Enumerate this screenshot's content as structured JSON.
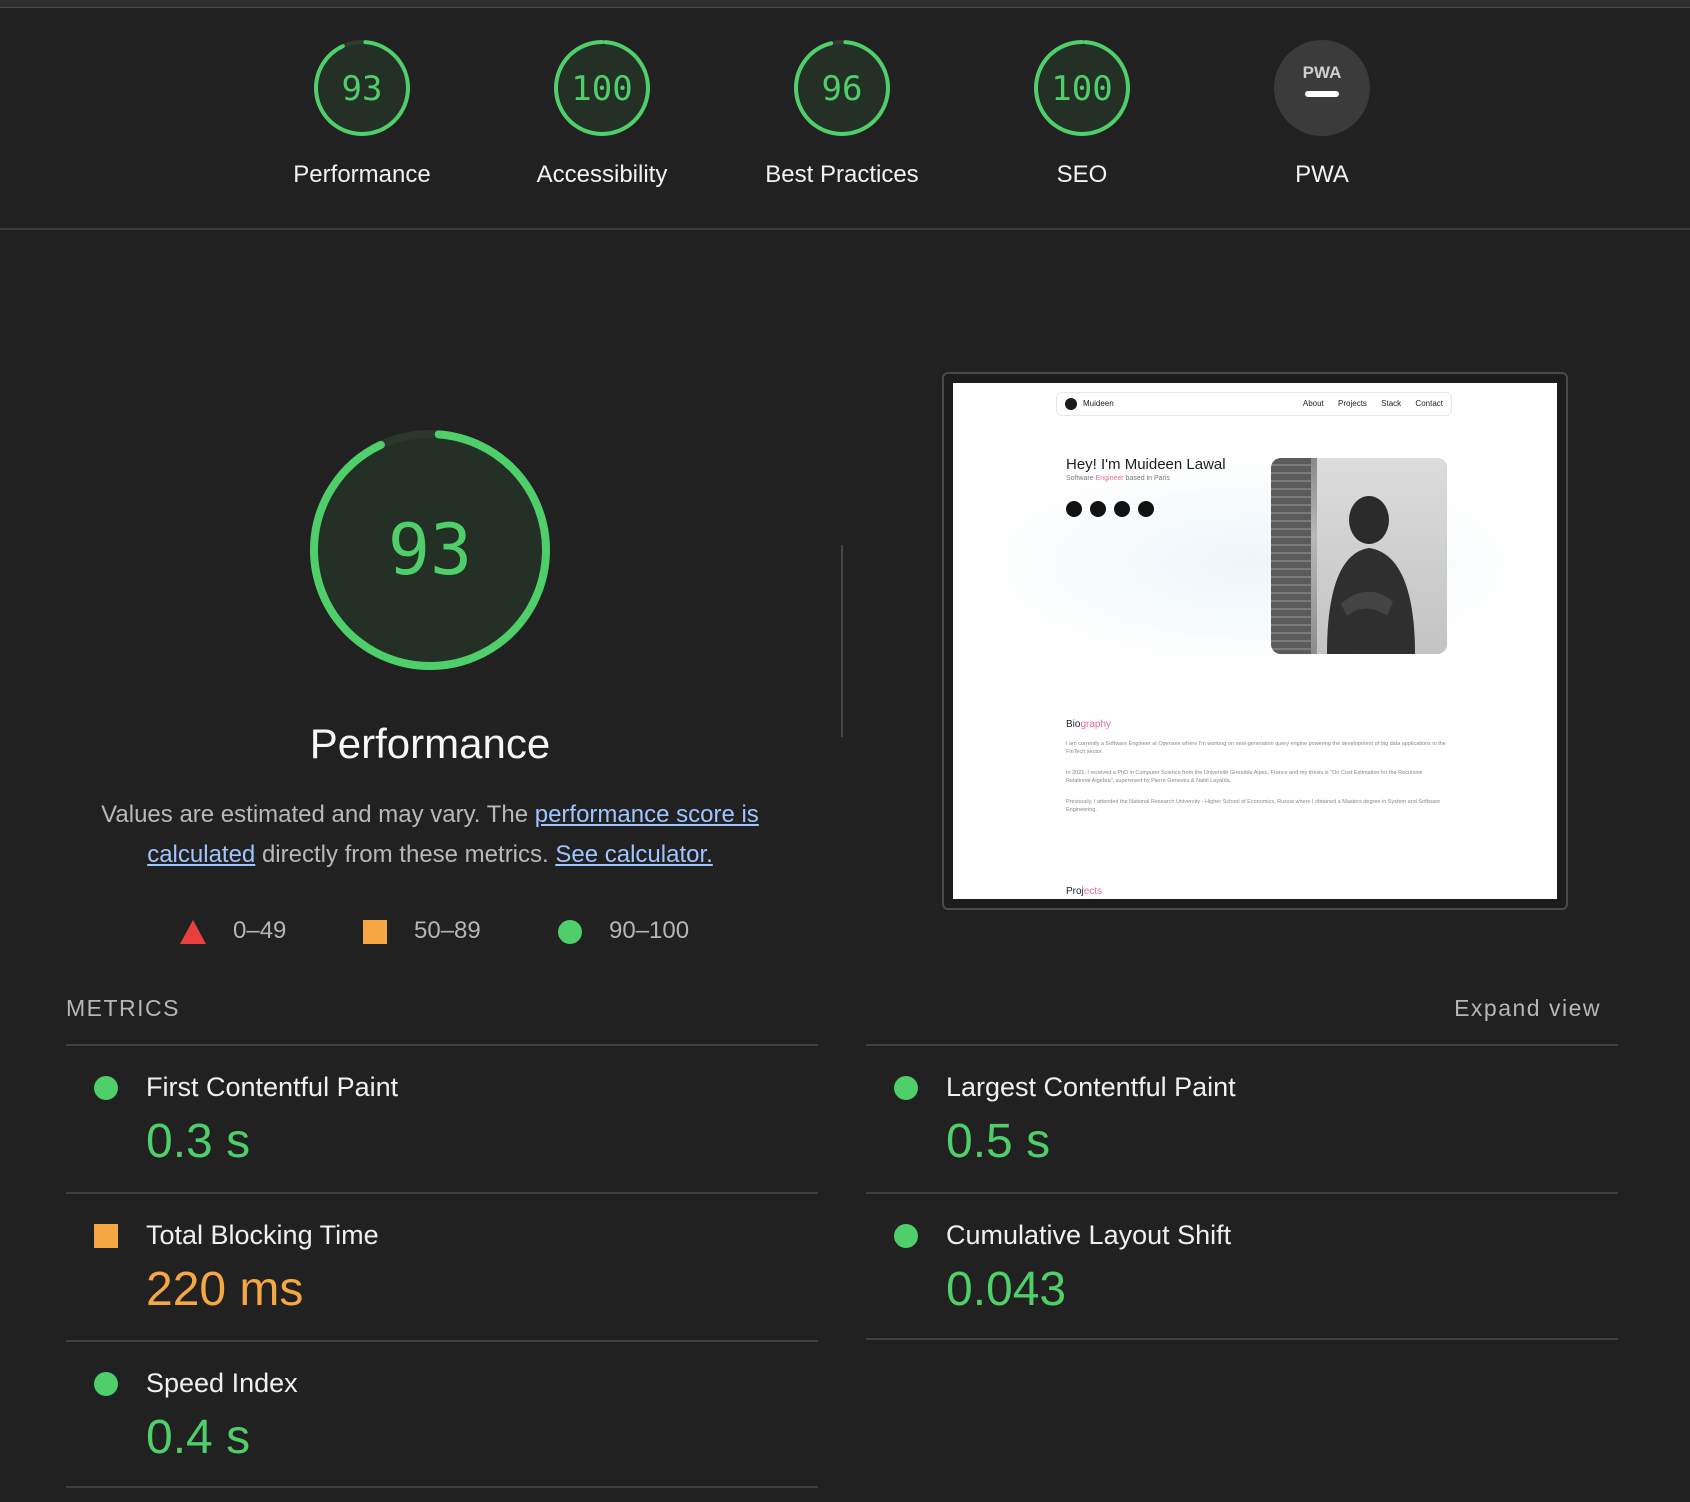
{
  "summary": {
    "gauges": [
      {
        "label": "Performance",
        "score": "93",
        "value": 0.93
      },
      {
        "label": "Accessibility",
        "score": "100",
        "value": 1.0
      },
      {
        "label": "Best Practices",
        "score": "96",
        "value": 0.96
      },
      {
        "label": "SEO",
        "score": "100",
        "value": 1.0
      },
      {
        "label": "PWA",
        "score": "PWA",
        "value": null
      }
    ]
  },
  "main": {
    "score": "93",
    "score_value": 0.93,
    "title": "Performance",
    "desc_prefix": "Values are estimated and may vary. The ",
    "desc_link": "performance score is calculated",
    "desc_middle": " directly from these metrics. ",
    "desc_calc_link": "See calculator.",
    "legend": {
      "fail": "0–49",
      "average": "50–89",
      "pass": "90–100"
    }
  },
  "screenshot": {
    "nav_brand": "Muideen",
    "nav_links": [
      "About",
      "Projects",
      "Stack",
      "Contact"
    ],
    "hero_title": "Hey! I'm Muideen Lawal",
    "hero_sub_1": "Software ",
    "hero_sub_accent": "Engineer",
    "hero_sub_2": " based in Paris",
    "bio_title_1": "Bio",
    "bio_title_accent": "graphy",
    "bio_p1": "I am currently a Software Engineer at Opensee where I'm working on next-generation query engine powering the development of big data applications in the FinTech sector.",
    "bio_p2": "In 2021, I received a PhD in Computer Science from the Université Grenoble Alpes, France and my thesis is \"On Cost Estimation for the Recursive Relational Algebra\", supervised by Pierre Genevès & Nabil Layaïda.",
    "bio_p3": "Previously, I attended the National Research University - Higher School of Economics, Russia where I obtained a Masters degree in System and Software Engineering.",
    "projects_title_1": "Proj",
    "projects_title_accent": "ects"
  },
  "metrics": {
    "heading": "METRICS",
    "expand_label": "Expand view",
    "items": [
      {
        "label": "First Contentful Paint",
        "value": "0.3 s",
        "status": "pass"
      },
      {
        "label": "Largest Contentful Paint",
        "value": "0.5 s",
        "status": "pass"
      },
      {
        "label": "Total Blocking Time",
        "value": "220 ms",
        "status": "average"
      },
      {
        "label": "Cumulative Layout Shift",
        "value": "0.043",
        "status": "pass"
      },
      {
        "label": "Speed Index",
        "value": "0.4 s",
        "status": "pass"
      }
    ]
  },
  "colors": {
    "pass": "#4fcf6a",
    "average": "#f4a742",
    "fail": "#e8413b",
    "background": "#212121"
  }
}
